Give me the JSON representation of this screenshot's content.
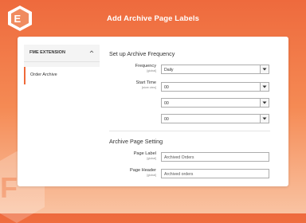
{
  "header": {
    "title": "Add Archive Page Labels",
    "logo_icon": "fme-logo-icon"
  },
  "sidebar": {
    "section_label": "FME EXTENSION",
    "items": [
      {
        "label": "Order Archive",
        "active": true
      }
    ]
  },
  "frequency_section": {
    "title": "Set up Archive Frequency",
    "frequency": {
      "label": "Frequency",
      "scope": "[global]",
      "value": "Daily"
    },
    "start_time": {
      "label": "Start Time",
      "scope": "[store view]",
      "hour": "00",
      "minute": "00",
      "second": "00"
    }
  },
  "page_section": {
    "title": "Archive Page Setting",
    "page_label": {
      "label": "Page Label",
      "scope": "[global]",
      "value": "Archived Orders"
    },
    "page_header": {
      "label": "Page Header",
      "scope": "[global]",
      "value": "Archived orders"
    }
  },
  "colors": {
    "brand": "#ee6a3d",
    "active_border": "#ef6a3a"
  }
}
